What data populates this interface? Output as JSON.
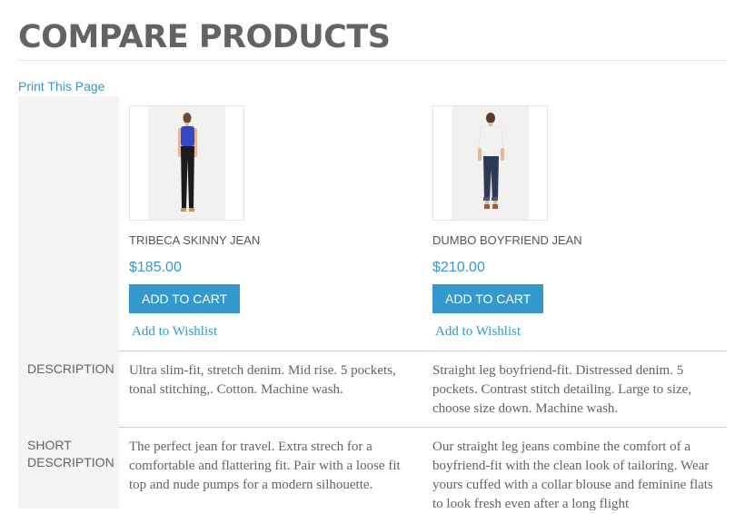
{
  "page": {
    "title": "COMPARE PRODUCTS",
    "print_link": "Print This Page"
  },
  "rows": {
    "description_label": "DESCRIPTION",
    "short_description_label": "SHORT DESCRIPTION"
  },
  "products": [
    {
      "name": "TRIBECA SKINNY JEAN",
      "price": "$185.00",
      "add_to_cart": "ADD TO CART",
      "wishlist": "Add to Wishlist",
      "description": "Ultra slim-fit, stretch denim. Mid rise. 5 pockets, tonal stitching,. Cotton. Machine wash.",
      "short_description": "The perfect jean for travel. Extra strech for a comfortable and flattering fit. Pair with a loose fit top and nude pumps for a modern silhouette.",
      "top_color": "#3347c8",
      "bottom_color": "#1c1c1e"
    },
    {
      "name": "DUMBO BOYFRIEND JEAN",
      "price": "$210.00",
      "add_to_cart": "ADD TO CART",
      "wishlist": "Add to Wishlist",
      "description": "Straight leg boyfriend-fit. Distressed denim. 5 pockets. Contrast stitch detailing. Large to size, choose size down. Machine wash.",
      "short_description": "Our straight leg jeans combine the comfort of a boyfriend-fit with the clean look of tailoring. Wear yours cuffed with a collar blouse and feminine flats to look fresh even after a long flight",
      "top_color": "#f2f2f2",
      "bottom_color": "#2e3a55"
    }
  ],
  "colors": {
    "accent": "#3399cc",
    "label_column_bg": "#f4f4f4",
    "title_text": "#636363"
  }
}
